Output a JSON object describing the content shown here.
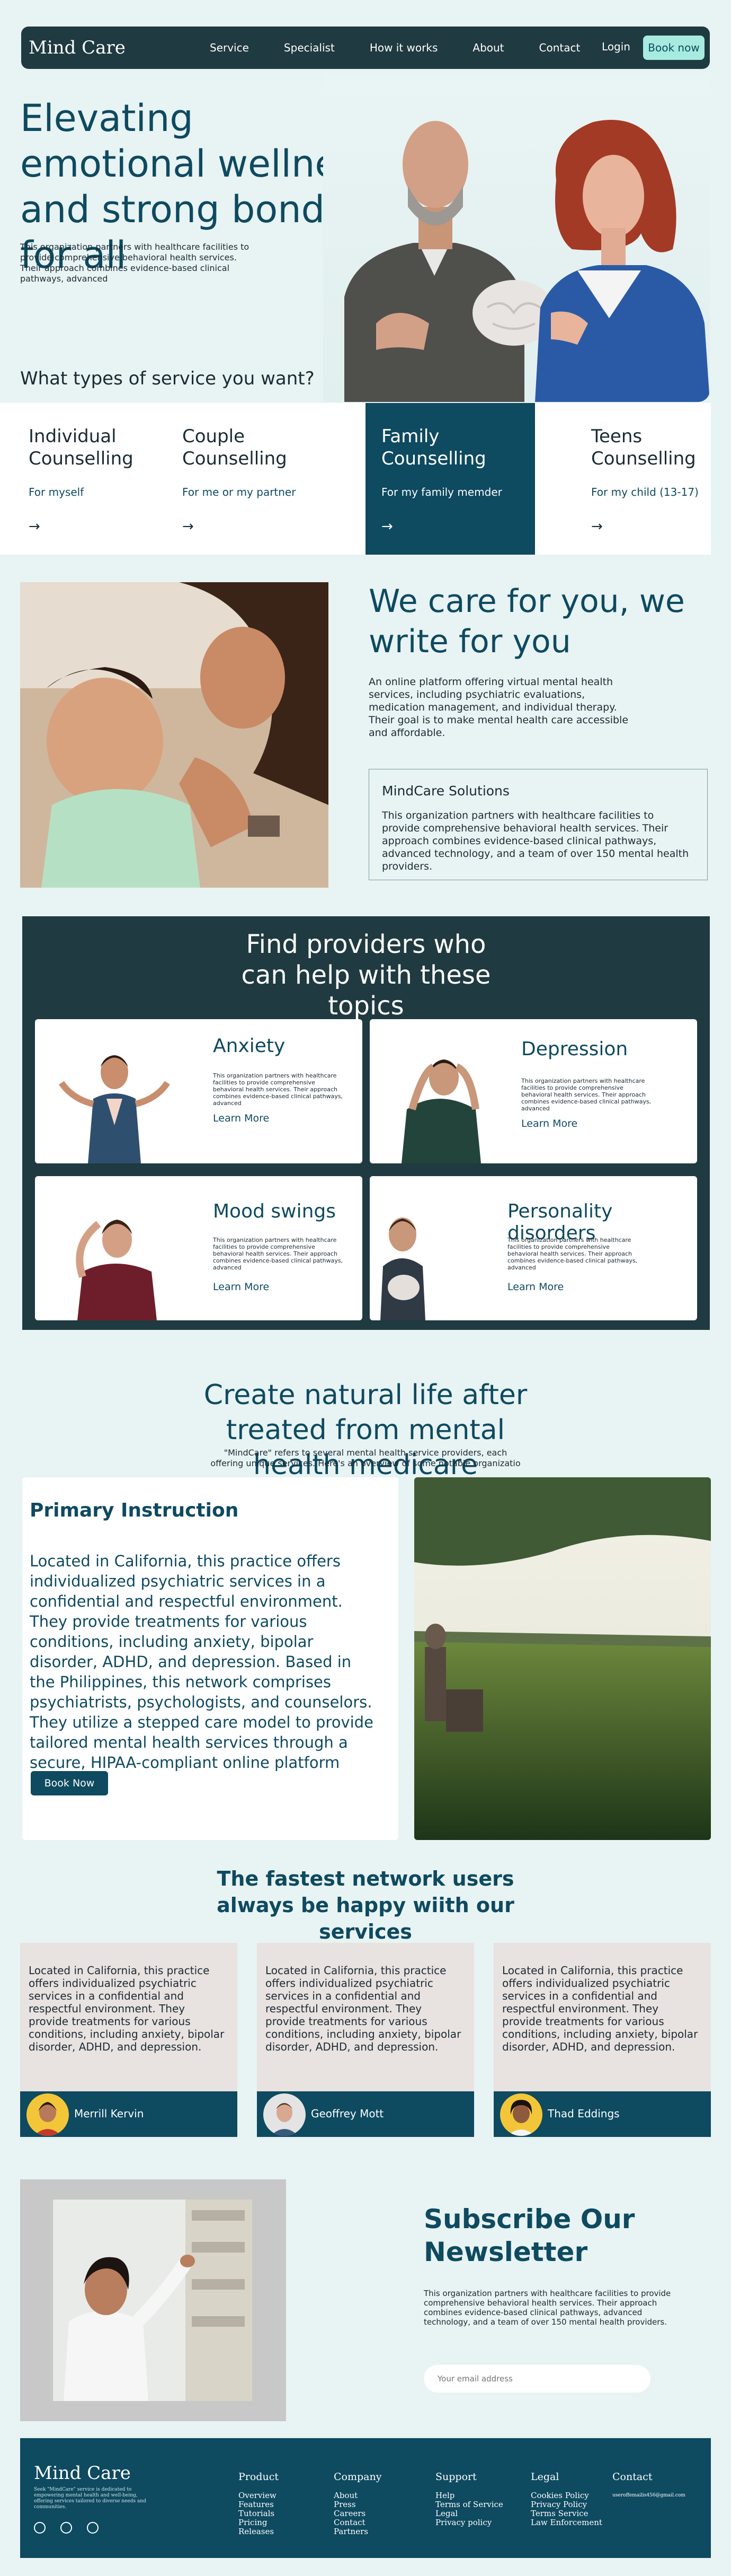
{
  "nav": {
    "brand": "Mind Care",
    "links": [
      "Service",
      "Specialist",
      "How it works",
      "About",
      "Contact"
    ],
    "login": "Login",
    "book": "Book now"
  },
  "hero": {
    "title": "Elevating emotional wellness and strong bonds for all",
    "description": "This organization partners with healthcare facilities to provide comprehensive behavioral health services. Their approach combines evidence-based clinical pathways, advanced"
  },
  "services": {
    "question": "What types of service you want?",
    "cards": [
      {
        "title": "Individual Counselling",
        "for": "For myself",
        "arrow": "→"
      },
      {
        "title": "Couple Counselling",
        "for": "For me or my partner",
        "arrow": "→"
      },
      {
        "title": "Family Counselling",
        "for": "For my family memder",
        "arrow": "→"
      },
      {
        "title": "Teens Counselling",
        "for": "For  my child (13-17)",
        "arrow": "→"
      }
    ]
  },
  "care": {
    "title": "We care for you, we write for you",
    "description": "An online platform offering virtual mental health services, including psychiatric evaluations, medication management, and individual therapy. Their goal is to make mental health care accessible and affordable.",
    "box_title": "MindCare Solutions",
    "box_text": "This organization partners with healthcare facilities to provide comprehensive behavioral health services. Their approach combines evidence-based clinical pathways, advanced technology, and a team of over 150 mental health providers."
  },
  "providers": {
    "title": "Find providers who can help with these topics",
    "cards": [
      {
        "title": "Anxiety",
        "text": "This organization partners with healthcare facilities to provide comprehensive behavioral health services. Their approach combines evidence-based clinical pathways, advanced",
        "link": "Learn More"
      },
      {
        "title": "Depression",
        "text": "This organization partners with healthcare facilities to provide comprehensive behavioral health services. Their approach combines evidence-based clinical pathways, advanced",
        "link": "Learn More"
      },
      {
        "title": "Mood swings",
        "text": "This organization partners with healthcare facilities to provide comprehensive behavioral health services. Their approach combines evidence-based clinical pathways, advanced",
        "link": "Learn More"
      },
      {
        "title": "Personality disorders",
        "text": "This organization partners with healthcare facilities to provide comprehensive behavioral health services. Their approach combines evidence-based clinical pathways, advanced",
        "link": "Learn More"
      }
    ]
  },
  "natural": {
    "title": "Create natural life after treated from mental health medicare",
    "subtitle": "\"MindCare\" refers to several mental health service providers, each offering unique services. Here's an overview of some notable organizatio",
    "box_title": "Primary Instruction",
    "box_text": "Located in California, this practice offers individualized psychiatric services in a confidential and respectful environment. They provide treatments for various conditions, including anxiety, bipolar disorder, ADHD, and depression. Based in the Philippines, this network comprises psychiatrists, psychologists, and counselors. They utilize a stepped care model to provide tailored mental health services through a secure, HIPAA-compliant online platform",
    "button": "Book Now"
  },
  "testimonials": {
    "title": "The fastest network users always be happy wiith our services",
    "cards": [
      {
        "text": "Located in California, this practice offers individualized psychiatric services in a confidential and respectful environment. They provide treatments for various conditions, including anxiety, bipolar disorder, ADHD, and depression.",
        "name": "Merrill Kervin"
      },
      {
        "text": "Located in California, this practice offers individualized psychiatric services in a confidential and respectful environment. They provide treatments for various conditions, including anxiety, bipolar disorder, ADHD, and depression.",
        "name": "Geoffrey Mott"
      },
      {
        "text": "Located in California, this practice offers individualized psychiatric services in a confidential and respectful environment. They provide treatments for various conditions, including anxiety, bipolar disorder, ADHD, and depression.",
        "name": "Thad Eddings"
      }
    ]
  },
  "newsletter": {
    "title": "Subscribe  Our Newsletter",
    "description": "This organization partners with healthcare facilities to provide comprehensive behavioral health services. Their approach combines evidence-based clinical pathways, advanced technology, and a team of over 150 mental health providers.",
    "placeholder": "Your email address"
  },
  "footer": {
    "brand": "Mind Care",
    "description": "Seek \"MindCare\" service is dedicated to empowering mental health and well-being, offering services tailored to diverse needs and communities.",
    "columns": [
      {
        "heading": "Product",
        "items": [
          "Overview",
          "Features",
          "Tutorials",
          "Pricing",
          "Releases"
        ]
      },
      {
        "heading": "Company",
        "items": [
          "About",
          "Press",
          "Careers",
          "Contact",
          "Partners"
        ]
      },
      {
        "heading": "Support",
        "items": [
          "Help",
          "Terms of Service",
          "Legal",
          "Privacy policy"
        ]
      },
      {
        "heading": "Legal",
        "items": [
          "Cookies Policy",
          "Privacy Policy",
          "Terms Service",
          "Law Enforcement"
        ]
      },
      {
        "heading": "Contact",
        "items": [
          "useroffemailis456@gmail.com"
        ]
      }
    ],
    "social_icons": [
      "instagram-icon",
      "facebook-icon",
      "vine-icon"
    ]
  },
  "colors": {
    "background": "#e8f3f3",
    "primary": "#0e4a60",
    "dark": "#1f3a40",
    "accent": "#a7ebe0"
  }
}
